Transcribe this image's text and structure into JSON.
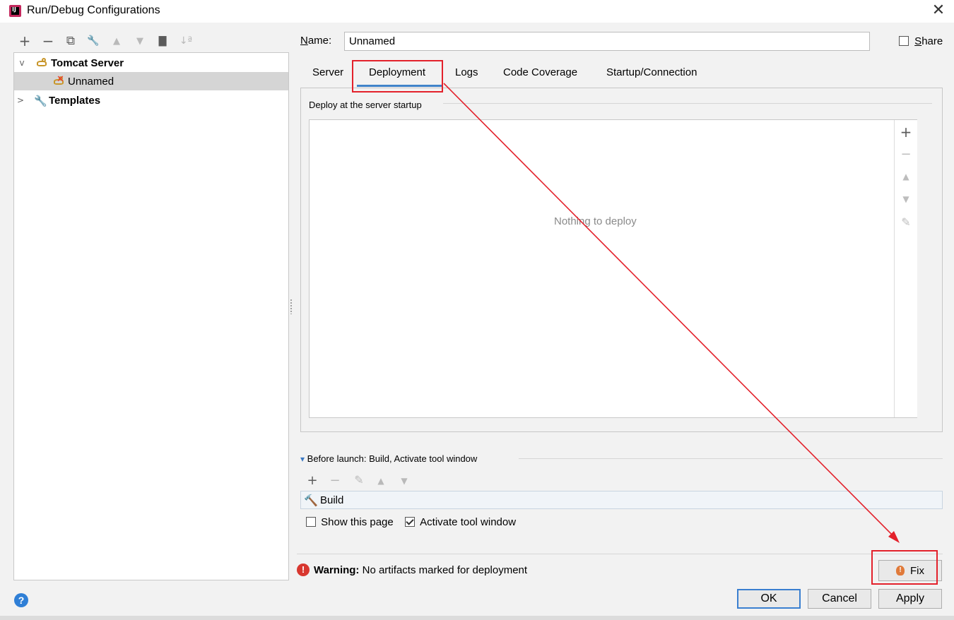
{
  "window": {
    "title": "Run/Debug Configurations",
    "close_glyph": "✕",
    "app_icon_text": "IJ"
  },
  "toolbar": {
    "icons": [
      "add-icon",
      "remove-icon",
      "copy-icon",
      "wrench-icon",
      "move-up-icon",
      "move-down-icon",
      "new-folder-icon",
      "sort-icon"
    ],
    "add": "+",
    "remove": "−",
    "copy": "⧉",
    "edit": "🔧",
    "up": "▲",
    "down": "▼",
    "folder": "▇",
    "sort": "↓ª"
  },
  "tree": {
    "items": [
      {
        "label": "Tomcat Server",
        "expanded": true
      },
      {
        "label": "Unnamed",
        "selected": true
      },
      {
        "label": "Templates",
        "expanded": false
      }
    ],
    "expanded_glyph": "v",
    "collapsed_glyph": ">"
  },
  "name_field": {
    "label": "Name:",
    "value": "Unnamed"
  },
  "share": {
    "label": "Share",
    "checked": false
  },
  "tabs": [
    {
      "label": "Server"
    },
    {
      "label": "Deployment",
      "active": true
    },
    {
      "label": "Logs"
    },
    {
      "label": "Code Coverage"
    },
    {
      "label": "Startup/Connection"
    }
  ],
  "deployment": {
    "section_label": "Deploy at the server startup",
    "empty_text": "Nothing to deploy",
    "side_icons": {
      "add": "+",
      "remove": "−",
      "up": "▲",
      "down": "▼",
      "edit": "✎"
    }
  },
  "before_launch": {
    "label": "Before launch: Build, Activate tool window",
    "toggle_glyph": "▾",
    "icons": {
      "add": "+",
      "remove": "−",
      "edit": "✎",
      "up": "▲",
      "down": "▼"
    },
    "items": [
      {
        "label": "Build"
      }
    ],
    "build_icon_glyph": "🔨"
  },
  "options": {
    "show_this_page": {
      "label": "Show this page",
      "checked": false
    },
    "activate_tool_window": {
      "label": "Activate tool window",
      "checked": true
    }
  },
  "warning": {
    "icon_glyph": "!",
    "prefix": "Warning:",
    "message": "No artifacts marked for deployment",
    "fix_label": "Fix",
    "fix_icon_glyph": "!"
  },
  "footer": {
    "help_glyph": "?",
    "ok": "OK",
    "cancel": "Cancel",
    "apply": "Apply"
  },
  "annotation": {
    "color": "#e3212b"
  },
  "colors": {
    "accent": "#4083c9",
    "error": "#d8372f",
    "highlight": "#e3212b"
  }
}
